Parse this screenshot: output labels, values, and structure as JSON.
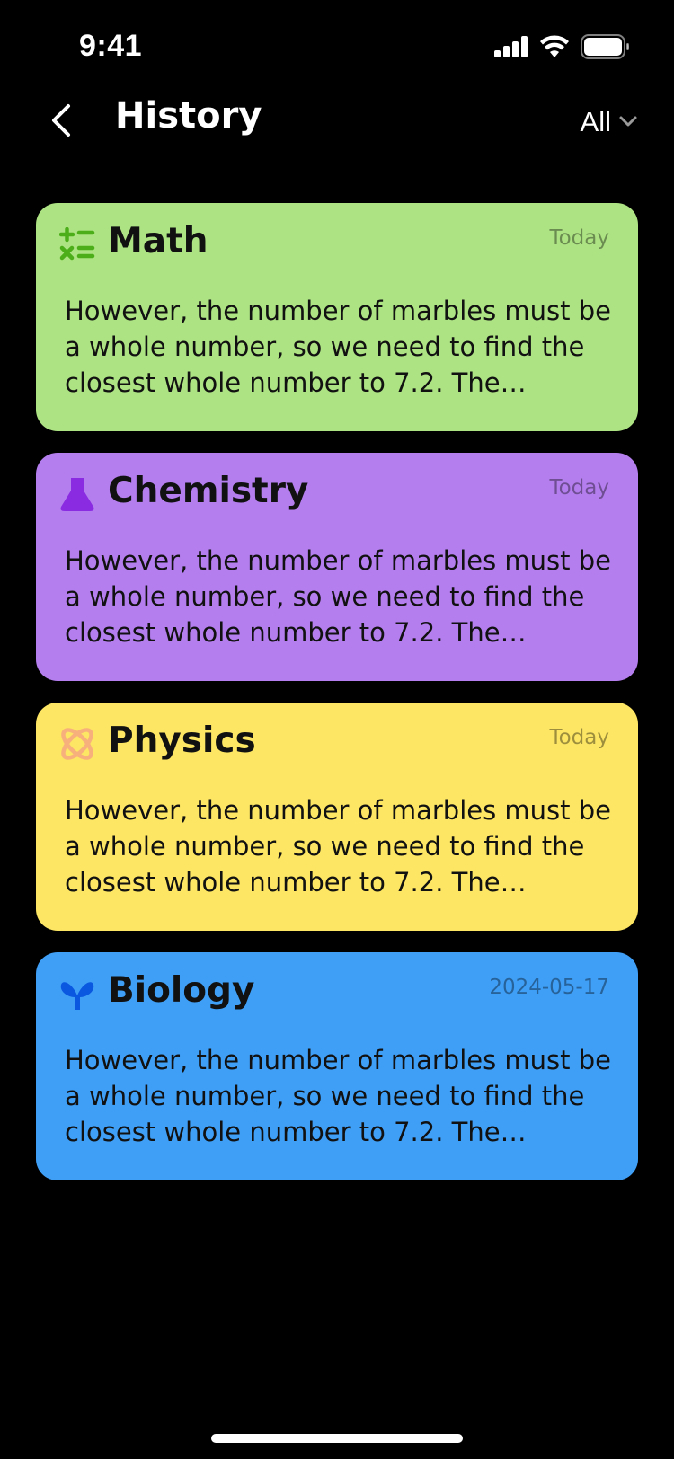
{
  "status_bar": {
    "time": "9:41"
  },
  "header": {
    "title": "History",
    "filter_label": "All"
  },
  "cards": [
    {
      "subject": "Math",
      "date": "Today",
      "text": "However, the number of marbles must be a whole number, so we need to find the closest whole number to 7.2. The…",
      "color": "#ade383",
      "icon": "calculator-symbols-icon",
      "icon_color": "#4caf1a"
    },
    {
      "subject": "Chemistry",
      "date": "Today",
      "text": "However, the number of marbles must be a whole number, so we need to find the closest whole number to 7.2. The…",
      "color": "#b47eee",
      "icon": "flask-icon",
      "icon_color": "#8a2be2"
    },
    {
      "subject": "Physics",
      "date": "Today",
      "text": "However, the number of marbles must be a whole number, so we need to find the closest whole number to 7.2. The…",
      "color": "#fde663",
      "icon": "atom-icon",
      "icon_color": "#f7b07c"
    },
    {
      "subject": "Biology",
      "date": "2024-05-17",
      "text": "However, the number of marbles must be a whole number, so we need to find the closest whole number to 7.2. The…",
      "color": "#3f9ff7",
      "icon": "sprout-icon",
      "icon_color": "#0a58e0"
    }
  ]
}
